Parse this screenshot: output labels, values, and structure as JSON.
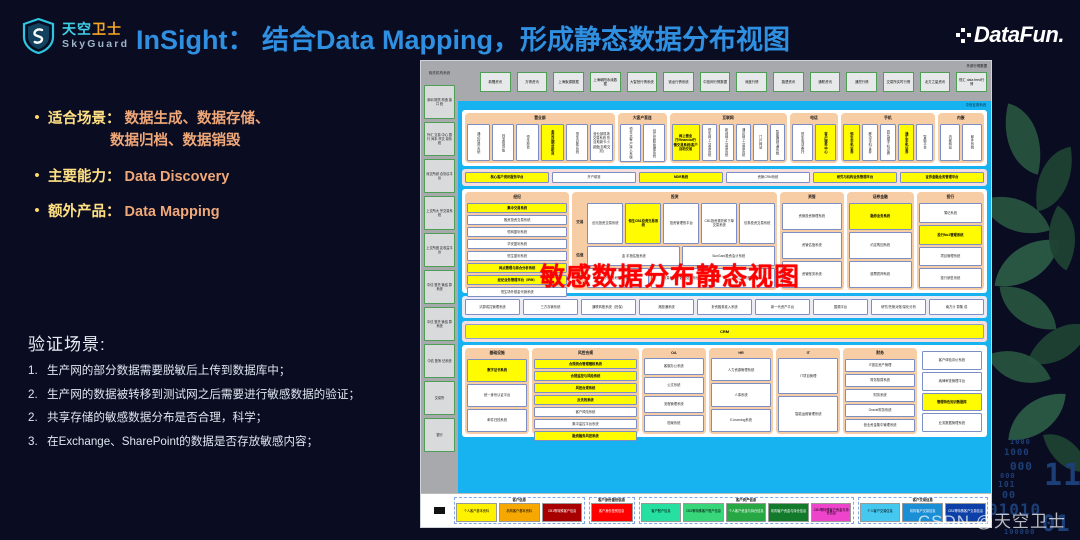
{
  "brand": {
    "logo_cn_1": "天空",
    "logo_cn_2": "卫士",
    "logo_en": "SkyGuard",
    "shield_icon": "shield-icon",
    "datafun": "DataFun.",
    "accent_blue": "#2f8fe0",
    "accent_yellow": "#ffe082",
    "accent_orange": "#f0a878",
    "background": "#0a0c22"
  },
  "header": {
    "title": "InSight： 结合Data Mapping，形成静态数据分布视图"
  },
  "bullets": [
    {
      "key": "适合场景：",
      "value": "数据生成、数据存储、",
      "value2": "数据归档、数据销毁"
    },
    {
      "key": "主要能力：",
      "value": "Data Discovery",
      "value2": ""
    },
    {
      "key": "额外产品：",
      "value": "Data Mapping",
      "value2": ""
    }
  ],
  "verify": {
    "heading": "验证场景:",
    "items": [
      {
        "num": "1.",
        "text": "生产网的部分数据需要脱敏后上传到数据库中；"
      },
      {
        "num": "2.",
        "text": "生产网的数据被转移到测试网之后需要进行敏感数据的验证；"
      },
      {
        "num": "2.",
        "text": "共享存储的敏感数据分布是否合理，科学；"
      },
      {
        "num": "3.",
        "text": "在Exchange、SharePoint的数据是否存放敏感内容；"
      }
    ]
  },
  "diagram": {
    "red_overlay": "敏感数据分布静态视图",
    "rail_header": "相关机构系统",
    "rail_items": [
      "深圳 期货 构造 接口 统",
      "外汇 交易 中心 银行 间本 币交 易系统",
      "深交所综 合协议平 台",
      "上交所大 宗交易系 统",
      "上交所固 定收益平 台",
      "中债 登托 管结 算系统",
      "中债 登托 管结 算系统",
      "中债 登簿 记系统",
      "交易所",
      "银行"
    ],
    "top_label": "外部行情数据",
    "top_boxes": [
      "新聞资讯",
      "万得资讯",
      "上海聚源数据",
      "上海朝阳永续数据",
      "大智慧行情系统",
      "钱龙行情系统",
      "中投网行情数据",
      "深度行情",
      "路透资讯",
      "通联资讯",
      "通挖行情",
      "交易所实时行情",
      "北方之星资讯",
      "恒汇 data feed行情"
    ],
    "blue_label": "中信证券系统",
    "channel_label": "渠道",
    "customer_label": "客户",
    "product_label": "产品",
    "rows": [
      {
        "type": "group_row",
        "groups": [
          {
            "title": "营业部",
            "vboxes": [
              "通达信用系统",
              "钱龙现场版",
              "恒生柜台",
              "金证达期货柜台",
              "恒生自助系统"
            ],
            "wide": "营业部现场交易系统 热自助新卡小键盘(自助交割)",
            "yellow": [
              "金证达期货柜台"
            ]
          },
          {
            "title": "大客户直连",
            "vboxes": [
              "恒生大客户接入系统",
              "创元控股管理系统"
            ],
            "yellow": []
          },
          {
            "title": "互联网",
            "yellow_wide": "网上营业厅/financial行情交易系统/客户自助交易",
            "vboxes": [
              "恒生网上交易系统",
              "新创网上交易系统",
              "通达网上交易系统",
              "门户网站",
              "智能理财通系统"
            ],
            "yellow": []
          },
          {
            "title": "电话",
            "vboxes": [
              "恒生电话委托",
              "客户服务中心"
            ],
            "yellow": [
              "客户服务中心"
            ]
          },
          {
            "title": "手机",
            "vboxes": [
              "恒生手机证券",
              "移动手机证券",
              "同花顺手机证券",
              "通汇手机证券",
              "智能平台"
            ],
            "yellow": [
              "恒生手机证券",
              "通汇手机证券"
            ]
          },
          {
            "title": "内嵌",
            "vboxes": [
              "内部网站",
              "邮件系统"
            ],
            "yellow": []
          }
        ]
      },
      {
        "type": "pink_row",
        "boxes": [
          {
            "t": "核心客户资讯服务平台",
            "y": true
          },
          {
            "t": "开户助准",
            "y": false
          },
          {
            "t": "MDR系统",
            "y": true
          },
          {
            "t": "资管CRM系统",
            "y": false
          },
          {
            "t": "研究与机构业务管理平台",
            "y": true
          },
          {
            "t": "证券金融业务管理平台",
            "y": true
          }
        ]
      },
      {
        "type": "group_row2",
        "groups": [
          {
            "title": "经纪",
            "boxes": [
              {
                "t": "集中交易系统",
                "y": true
              },
              {
                "t": "融资投资交易系统",
                "y": false
              },
              {
                "t": "恒网盈利系统",
                "y": false
              },
              {
                "t": "华安盈利系统",
                "y": false
              },
              {
                "t": "恒生盈利系统",
                "y": false
              },
              {
                "t": "网点管理与综合分析系统",
                "y": true
              },
              {
                "t": "经纪业务管理平台（IRM）",
                "y": true
              },
              {
                "t": "恒生场外基金代销系统",
                "y": false
              }
            ]
          },
          {
            "title": "投资",
            "rows": [
              {
                "lab": "交易",
                "boxes": [
                  {
                    "t": "创元投资交易系统",
                    "y": false
                  },
                  {
                    "t": "恒生CB1投资交易系统",
                    "y": true
                  },
                  {
                    "t": "投资管理快平台",
                    "y": false
                  },
                  {
                    "t": "CB1投资委托和下单交易系统",
                    "y": false
                  },
                  {
                    "t": "债券投资交易系统",
                    "y": false
                  }
                ]
              },
              {
                "lab": "估值",
                "boxes": [
                  {
                    "t": "金 手指估值系统",
                    "y": false
                  },
                  {
                    "t": "SunGard投资会计系统",
                    "y": false
                  }
                ]
              },
              {
                "lab": "研究",
                "boxes": [
                  {
                    "t": "万得投研管理平台",
                    "y": false
                  },
                  {
                    "t": "数量化分析数据处理系统",
                    "y": false
                  },
                  {
                    "t": "北方之星研究系统",
                    "y": false
                  }
                ]
              }
            ]
          },
          {
            "title": "资管",
            "boxes": [
              {
                "t": "资管投资管理系统",
                "y": false
              },
              {
                "t": "资管估值系统",
                "y": false
              },
              {
                "t": "资管账务系统",
                "y": false
              }
            ]
          },
          {
            "title": "证券金融",
            "boxes": [
              {
                "t": "融券业务系统",
                "y": true
              },
              {
                "t": "约定购回系统",
                "y": false
              },
              {
                "t": "股票质押系统",
                "y": false
              }
            ]
          },
          {
            "title": "投行",
            "boxes": [
              {
                "t": "薄记系统",
                "y": false
              },
              {
                "t": "投行No1管理系统",
                "y": true
              },
              {
                "t": "项目管理系统",
                "y": false
              },
              {
                "t": "投行销售系统",
                "y": false
              }
            ]
          }
        ]
      },
      {
        "type": "lav_row",
        "boxes": [
          "清算成控管理系统",
          "三方存管系统",
          "通联转账系统（担保）",
          "港股通系统",
          "折资融券准入系统",
          "新一代资产平台",
          "国顺平台",
          "研究/托管对账/量化分析",
          "南方计 算集 成"
        ]
      },
      {
        "type": "crm",
        "label": "CRM"
      },
      {
        "type": "group_row3",
        "groups": [
          {
            "title": "基础设施",
            "boxes": [
              {
                "t": "数字证书系统",
                "y": true
              },
              {
                "t": "统一身份认证平台",
                "y": false
              },
              {
                "t": "邮件归档系统",
                "y": false
              }
            ]
          },
          {
            "title": "风控合规",
            "boxes": [
              {
                "t": "合规统合管理稽核系统",
                "y": true
              },
              {
                "t": "合规监控与风险系统",
                "y": true
              },
              {
                "t": "风控合规系统",
                "y": true
              },
              {
                "t": "反洗钱系统",
                "y": true
              },
              {
                "t": "客户风险系统",
                "y": false
              },
              {
                "t": "集中监控平台系统",
                "y": false
              },
              {
                "t": "融资融券风控系统",
                "y": true
              }
            ]
          },
          {
            "title": "OA",
            "boxes": [
              {
                "t": "客服办公系统",
                "y": false
              },
              {
                "t": "公文系统",
                "y": false
              },
              {
                "t": "流程管理系统",
                "y": false
              },
              {
                "t": "档案系统",
                "y": false
              }
            ]
          },
          {
            "title": "HR",
            "boxes": [
              {
                "t": "人力资源管理系统",
                "y": false
              },
              {
                "t": "人事系统",
                "y": false
              },
              {
                "t": "E-learning系统",
                "y": false
              }
            ]
          },
          {
            "title": "IT",
            "boxes": [
              {
                "t": "IT项目管理",
                "y": false
              },
              {
                "t": "智能运维管理系统",
                "y": false
              }
            ]
          },
          {
            "title": "财务",
            "boxes": [
              {
                "t": "IT固定资产管理",
                "y": false
              },
              {
                "t": "财务核算系统",
                "y": false
              },
              {
                "t": "财务系统",
                "y": false
              },
              {
                "t": "Oracle财务系统",
                "y": false
              },
              {
                "t": "营业资金集中管理系统",
                "y": false
              }
            ]
          },
          {
            "title": "",
            "boxes": [
              {
                "t": "客户体验评价系统",
                "y": false
              },
              {
                "t": "纳律审查管理平台",
                "y": false
              },
              {
                "t": "管理特色知识数据库",
                "y": true
              },
              {
                "t": "业务数据管理系统",
                "y": false
              }
            ]
          }
        ]
      }
    ],
    "bottom_groups": [
      {
        "title": "客户信息",
        "chips": [
          {
            "t": "个人客户基本资料",
            "bg": "#fff200",
            "fg": "#000"
          },
          {
            "t": "机构客户基本资料",
            "bg": "#f7a800",
            "fg": "#000"
          },
          {
            "t": "CB1等特殊客户信息",
            "bg": "#a80000",
            "fg": "#fff"
          }
        ]
      },
      {
        "title": "客户身份鉴别信息",
        "chips": [
          {
            "t": "客户身份鉴别信息",
            "bg": "#ff0000",
            "fg": "#fff"
          }
        ]
      },
      {
        "title": "客户资产信息",
        "chips": [
          {
            "t": "客户账户信息",
            "bg": "#25e0a0",
            "fg": "#000"
          },
          {
            "t": "CB1等特殊客户账户信息",
            "bg": "#37d67a",
            "fg": "#000"
          },
          {
            "t": "个人客户资金与持仓信息",
            "bg": "#27a844",
            "fg": "#fff"
          },
          {
            "t": "机构客户资金与持仓信息",
            "bg": "#137a2b",
            "fg": "#fff"
          },
          {
            "t": "CB1等特殊客户资金与持仓信息",
            "bg": "#ee44cc",
            "fg": "#000"
          }
        ]
      },
      {
        "title": "客户交易信息",
        "chips": [
          {
            "t": "个人客户交易信息",
            "bg": "#45c8f0",
            "fg": "#000"
          },
          {
            "t": "机构客户交易信息",
            "bg": "#1b8fd6",
            "fg": "#fff"
          },
          {
            "t": "CB1等特殊客户交易信息",
            "bg": "#0d3fa8",
            "fg": "#fff"
          }
        ]
      }
    ]
  },
  "watermark": "CSDN @天空卫士"
}
